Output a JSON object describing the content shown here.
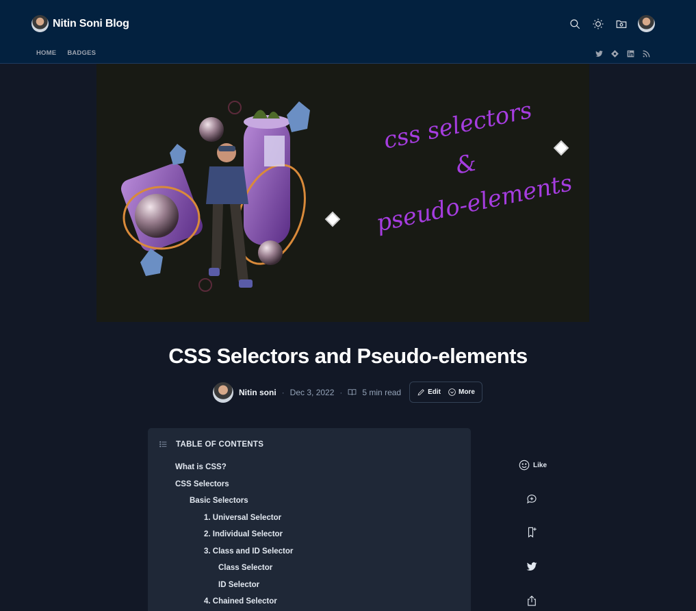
{
  "header": {
    "brand_name": "Nitin Soni Blog",
    "nav": [
      "HOME",
      "BADGES"
    ],
    "icons": [
      "search-icon",
      "sun-icon",
      "folder-icon",
      "profile-avatar"
    ],
    "social": [
      "twitter-icon",
      "hashnode-icon",
      "linkedin-icon",
      "rss-icon"
    ]
  },
  "cover": {
    "lines": [
      "css selectors",
      "&",
      "pseudo-elements"
    ]
  },
  "article": {
    "title": "CSS Selectors and Pseudo-elements",
    "author": "Nitin soni",
    "date": "Dec 3, 2022",
    "read_time": "5 min read",
    "edit_label": "Edit",
    "more_label": "More"
  },
  "toc": {
    "heading": "TABLE OF CONTENTS",
    "items": [
      {
        "label": "What is CSS?",
        "level": 1
      },
      {
        "label": "CSS Selectors",
        "level": 1
      },
      {
        "label": "Basic Selectors",
        "level": 2
      },
      {
        "label": "1. Universal Selector",
        "level": 3
      },
      {
        "label": "2. Individual Selector",
        "level": 3
      },
      {
        "label": "3. Class and ID Selector",
        "level": 3
      },
      {
        "label": "Class Selector",
        "level": 4
      },
      {
        "label": "ID Selector",
        "level": 4
      },
      {
        "label": "4. Chained Selector",
        "level": 3
      }
    ]
  },
  "side_actions": {
    "like_label": "Like"
  },
  "colors": {
    "header_bg": "#03213f",
    "page_bg": "#121826",
    "toc_bg": "#1f2837",
    "cover_text": "#a63de0"
  }
}
